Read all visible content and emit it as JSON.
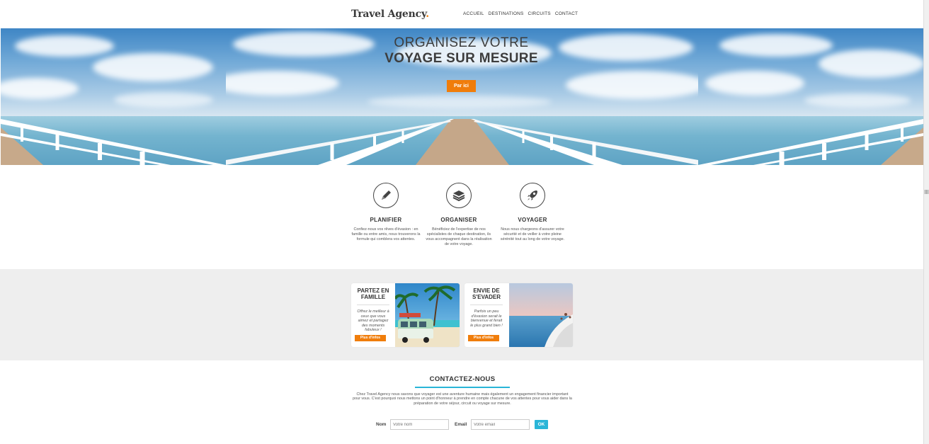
{
  "header": {
    "logo": "Travel Agency",
    "logo_dot": ".",
    "nav": [
      "ACCUEIL",
      "DESTINATIONS",
      "CIRCUITS",
      "CONTACT"
    ]
  },
  "hero": {
    "title_line1": "ORGANISEZ VOTRE",
    "title_line2": "VOYAGE SUR MESURE",
    "button": "Par ici"
  },
  "features": [
    {
      "icon": "pencil-icon",
      "title": "PLANIFIER",
      "text": "Confiez-nous vos rêves d'évasion : en famille ou entre amis, nous trouverons la formule qui comblera vos attentes."
    },
    {
      "icon": "layers-icon",
      "title": "ORGANISER",
      "text": "Bénéficiez de l'expertise de nos spécialistes de chaque destination, ils vous accompagnent dans la réalisation de votre voyage."
    },
    {
      "icon": "rocket-icon",
      "title": "VOYAGER",
      "text": "Nous nous chargeons d'assurer votre sécurité et de veiller à votre pleine sérénité tout au long de votre voyage."
    }
  ],
  "cards": [
    {
      "title": "PARTEZ EN FAMILLE",
      "text": "Offrez le meilleur à ceux que vous aimez et partagez des moments fabuleux !",
      "button": "Plus d'infos"
    },
    {
      "title": "ENVIE DE S'EVADER",
      "text": "Parfois un peu d'évasion serait le bienvenue et ferait le plus grand bien !",
      "button": "Plus d'infos"
    }
  ],
  "contact": {
    "title": "CONTACTEZ-NOUS",
    "description": "Chez Travel Agency nous savons que voyager est une aventure humaine mais également un engagement financier important pour vous. C'est pourquoi nous mettons un point d'honneur à prendre en compte chacune de vos attentes pour vous aider dans la préparation de votre séjour, circuit ou voyage sur mesure.",
    "name_label": "Nom",
    "name_placeholder": "Votre nom",
    "email_label": "Email",
    "email_placeholder": "Votre email",
    "submit": "OK"
  },
  "colors": {
    "accent": "#f07d0b",
    "secondary": "#29b5d8",
    "band_bg": "#eeeeee"
  }
}
